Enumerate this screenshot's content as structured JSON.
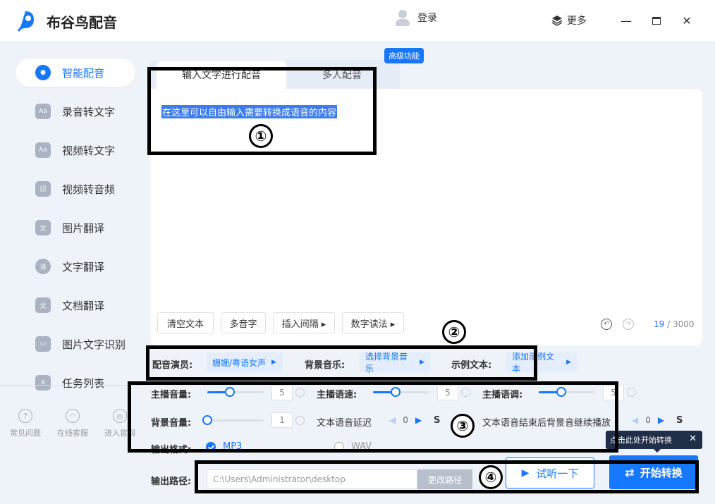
{
  "app": {
    "title": "布谷鸟配音"
  },
  "header": {
    "login": "登录",
    "more": "更多",
    "minimize": "—",
    "close": "✕"
  },
  "sidebar": {
    "items": [
      {
        "label": "智能配音",
        "glyph": "●"
      },
      {
        "label": "录音转文字",
        "glyph": "Aa"
      },
      {
        "label": "视频转文字",
        "glyph": "Aa"
      },
      {
        "label": "视频转音频",
        "glyph": "|||"
      },
      {
        "label": "图片翻译",
        "glyph": "文"
      },
      {
        "label": "文字翻译",
        "glyph": "译"
      },
      {
        "label": "文档翻译",
        "glyph": "文"
      },
      {
        "label": "图片文字识别",
        "glyph": "▭"
      },
      {
        "label": "任务列表",
        "glyph": "≡"
      }
    ],
    "footer": [
      {
        "label": "常见问题",
        "glyph": "?"
      },
      {
        "label": "在线客服",
        "glyph": "◠"
      },
      {
        "label": "进入官网",
        "glyph": "◎"
      }
    ]
  },
  "tabs": {
    "active": "输入文字进行配音",
    "other": "多人配音",
    "badge": "高级功能"
  },
  "editor": {
    "placeholder": "在这里可以自由输入需要转换成语音的内容",
    "tools": [
      "清空文本",
      "多音字",
      "插入间隔 ▸",
      "数字读法 ▸"
    ],
    "count_current": "19",
    "count_total": " / 3000"
  },
  "settings": {
    "voice_label": "配音演员:",
    "voice_value": "姗姗/粤语女声",
    "bgm_label": "背景音乐:",
    "bgm_value": "选择背景音乐",
    "sample_label": "示例文本:",
    "sample_value": "添加示例文本",
    "volume_label": "主播音量:",
    "volume_value": "5",
    "volume_level": 0.4,
    "speed_label": "主播语速:",
    "speed_value": "5",
    "speed_level": 0.4,
    "pitch_label": "主播语调:",
    "pitch_value": "5",
    "pitch_level": 0.4,
    "bg_volume_label": "背景音量:",
    "bg_volume_value": "1",
    "bg_volume_level": 0.0,
    "delay_label": "文本语音延迟",
    "delay_value": "0",
    "continue_label": "文本语音结束后背景音继续播放",
    "continue_value": "0",
    "unit": "S",
    "format_label": "输出格式:",
    "format_mp3": "MP3",
    "format_wav": "WAV",
    "path_label": "输出路径:",
    "path_value": "C:\\Users\\Administrator\\desktop",
    "path_button": "更改路径"
  },
  "actions": {
    "preview": "试听一下",
    "start": "开始转换",
    "tooltip": "点击此处开始转换"
  },
  "annotations": [
    "①",
    "②",
    "③",
    "④"
  ],
  "colors": {
    "accent": "#1677ff",
    "sidebar_bg": "#eef2f9",
    "tooltip_bg": "#1f2f47"
  }
}
